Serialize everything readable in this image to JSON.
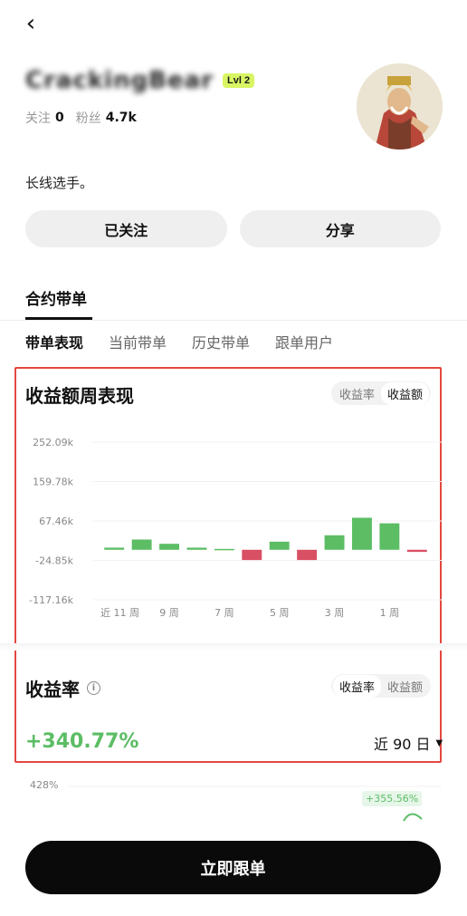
{
  "header": {
    "back_icon": "chevron-left-icon"
  },
  "profile": {
    "name": "CrackingBear",
    "level": "Lvl 2",
    "following_label": "关注",
    "following_count": "0",
    "followers_label": "粉丝",
    "followers_count": "4.7k",
    "bio": "长线选手。"
  },
  "buttons": {
    "followed": "已关注",
    "share": "分享"
  },
  "section": {
    "title": "合约带单"
  },
  "subtabs": [
    "带单表现",
    "当前带单",
    "历史带单",
    "跟单用户"
  ],
  "weekly_card": {
    "title": "收益额周表现",
    "toggle": [
      "收益率",
      "收益额"
    ]
  },
  "chart_data": {
    "type": "bar",
    "y_ticks": [
      "252.09k",
      "159.78k",
      "67.46k",
      "-24.85k",
      "-117.16k"
    ],
    "x_ticks": [
      "近 11 周",
      "9 周",
      "7 周",
      "5 周",
      "3 周",
      "1 周"
    ],
    "ylim": [
      -117.16,
      252.09
    ],
    "values": [
      5,
      24,
      14,
      5,
      2,
      -24,
      19,
      -24,
      34,
      75,
      62,
      -5
    ],
    "colors": {
      "positive": "#5cbd65",
      "negative": "#d94f63"
    }
  },
  "rate_card": {
    "title": "收益率",
    "toggle": [
      "收益率",
      "收益额"
    ],
    "value": "+340.77%",
    "period": "近 90 日",
    "mini_ylabel": "428%",
    "mini_badge": "+355.56%"
  },
  "cta": {
    "label": "立即跟单"
  }
}
